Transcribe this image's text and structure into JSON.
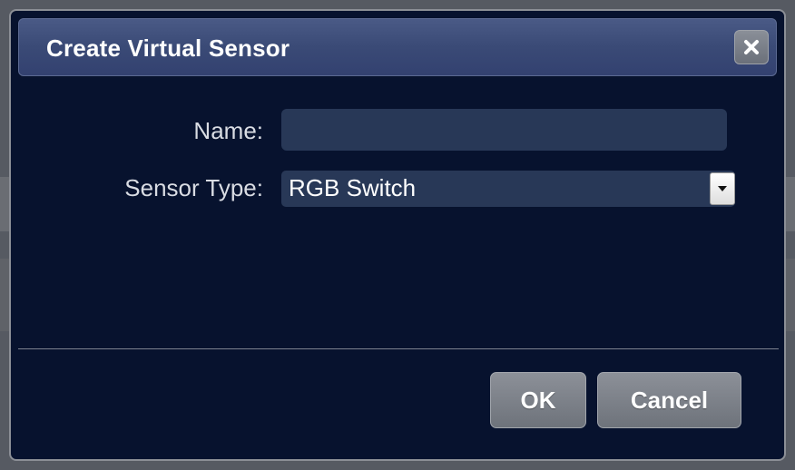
{
  "dialog": {
    "title": "Create Virtual Sensor",
    "close_icon": "close-icon"
  },
  "form": {
    "name_label": "Name:",
    "name_value": "",
    "sensor_type_label": "Sensor Type:",
    "sensor_type_value": "RGB Switch",
    "dropdown_icon": "chevron-down-icon"
  },
  "buttons": {
    "ok_label": "OK",
    "cancel_label": "Cancel"
  },
  "colors": {
    "dialog_bg": "#07122e",
    "titlebar": "#3a4a76",
    "input_bg": "#283857",
    "button": "#7d8189"
  }
}
